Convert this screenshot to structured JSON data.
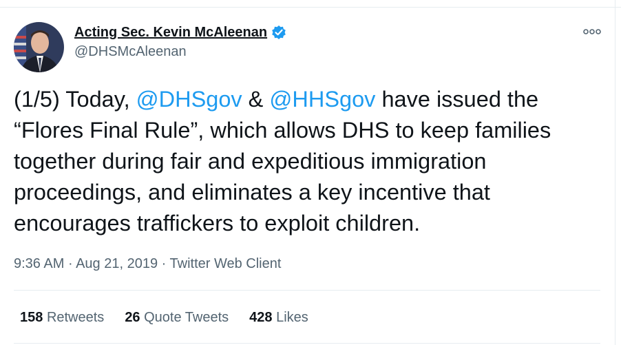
{
  "author": {
    "display_name": "Acting Sec. Kevin McAleenan",
    "handle": "@DHSMcAleenan",
    "verified": true,
    "verified_icon": "verified-badge-icon"
  },
  "tweet": {
    "segments": [
      {
        "text": "(1/5) Today, ",
        "type": "text"
      },
      {
        "text": "@DHSgov",
        "type": "mention"
      },
      {
        "text": " & ",
        "type": "text"
      },
      {
        "text": "@HHSgov",
        "type": "mention"
      },
      {
        "text": " have issued the “Flores Final Rule”, which allows DHS to keep families together during fair and expeditious immigration proceedings, and eliminates a key incentive that encourages traffickers to exploit children.",
        "type": "text"
      }
    ]
  },
  "meta": {
    "time": "9:36 AM",
    "date": "Aug 21, 2019",
    "client": "Twitter Web Client",
    "separator": "·"
  },
  "stats": {
    "retweets_count": "158",
    "retweets_label": "Retweets",
    "quotes_count": "26",
    "quotes_label": "Quote Tweets",
    "likes_count": "428",
    "likes_label": "Likes"
  },
  "colors": {
    "mention": "#1d9bf0",
    "secondary_text": "#536471",
    "verified": "#1d9bf0",
    "divider": "#e6ecf0"
  },
  "icons": {
    "more": "more-options-icon"
  }
}
